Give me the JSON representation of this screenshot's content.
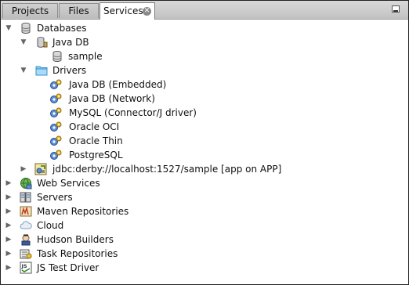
{
  "tabs": [
    {
      "label": "Projects"
    },
    {
      "label": "Files"
    },
    {
      "label": "Services"
    }
  ],
  "tree": {
    "databases": "Databases",
    "java_db": "Java DB",
    "sample": "sample",
    "drivers": "Drivers",
    "driver_items": [
      "Java DB (Embedded)",
      "Java DB (Network)",
      "MySQL (Connector/J driver)",
      "Oracle OCI",
      "Oracle Thin",
      "PostgreSQL"
    ],
    "connection": "jdbc:derby://localhost:1527/sample [app on APP]",
    "web_services": "Web Services",
    "servers": "Servers",
    "maven_repositories": "Maven Repositories",
    "cloud": "Cloud",
    "hudson_builders": "Hudson Builders",
    "task_repositories": "Task Repositories",
    "js_test_driver": "JS Test Driver"
  },
  "icons": {
    "expanded": "triangle-down-icon",
    "collapsed": "triangle-right-icon",
    "database": "database-icon",
    "folder": "folder-icon",
    "driver": "gear-driver-icon",
    "connection": "connection-icon"
  }
}
